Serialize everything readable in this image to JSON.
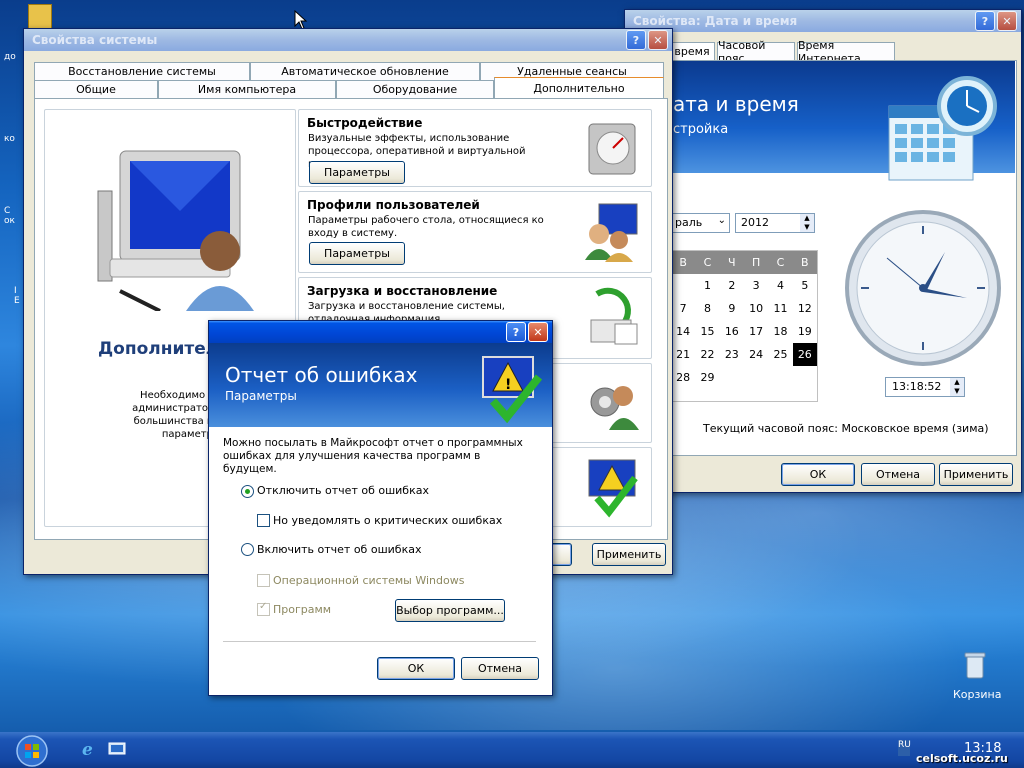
{
  "desktop": {
    "recycle_bin_label": "Корзина",
    "watermark": "celsoft.ucoz.ru"
  },
  "taskbar": {
    "clock": "13:18",
    "lang": "RU",
    "start_icon": "windows-orb-icon",
    "quicklaunch": [
      "internet-explorer-icon",
      "show-desktop-icon"
    ]
  },
  "sysprops": {
    "title": "Свойства системы",
    "tabs_row1": [
      "Восстановление системы",
      "Автоматическое обновление",
      "Удаленные сеансы"
    ],
    "tabs_row2": [
      "Общие",
      "Имя компьютера",
      "Оборудование",
      "Дополнительно"
    ],
    "left_title": "Дополнител",
    "left_text": "Необходимо иметь п\nадминистратора для из\nбольшинства перечисл\nпараметров.",
    "groups": [
      {
        "title": "Быстродействие",
        "desc": "Визуальные эффекты, использование процессора, оперативной и виртуальной памяти.",
        "button": "Параметры"
      },
      {
        "title": "Профили пользователей",
        "desc": "Параметры рабочего стола, относящиеся ко входу в систему.",
        "button": "Параметры"
      },
      {
        "title": "Загрузка и восстановление",
        "desc": "Загрузка и восстановление системы, отладочная информация."
      }
    ],
    "ok_label": "на",
    "apply_label": "Применить"
  },
  "datetime": {
    "title": "Свойства: Дата и время",
    "tabs": [
      "время",
      "Часовой пояс",
      "Время Интернета"
    ],
    "header_title": "ата и время",
    "header_sub": "стройка",
    "month": "раль",
    "year": "2012",
    "weekdays": [
      "В",
      "С",
      "Ч",
      "П",
      "С",
      "В"
    ],
    "weeks": [
      [
        "",
        "1",
        "2",
        "3",
        "4",
        "5"
      ],
      [
        "7",
        "8",
        "9",
        "10",
        "11",
        "12"
      ],
      [
        "14",
        "15",
        "16",
        "17",
        "18",
        "19"
      ],
      [
        "21",
        "22",
        "23",
        "24",
        "25",
        "26"
      ],
      [
        "28",
        "29",
        "",
        "",
        "",
        ""
      ]
    ],
    "selected_day": "26",
    "time": "13:18:52",
    "timezone": "Текущий часовой пояс: Московское время (зима)",
    "ok": "ОК",
    "cancel": "Отмена",
    "apply": "Применить"
  },
  "errdlg": {
    "title_main": "Отчет об ошибках",
    "title_sub": "Параметры",
    "intro": "Можно посылать в Майкрософт отчет о программных ошибках для улучшения качества программ в будущем.",
    "opt_disable": "Отключить отчет об ошибках",
    "opt_notify": "Но уведомлять о критических ошибках",
    "opt_enable": "Включить отчет об ошибках",
    "opt_os": "Операционной системы Windows",
    "opt_programs": "Программ",
    "choose_programs": "Выбор программ...",
    "ok": "ОК",
    "cancel": "Отмена"
  }
}
